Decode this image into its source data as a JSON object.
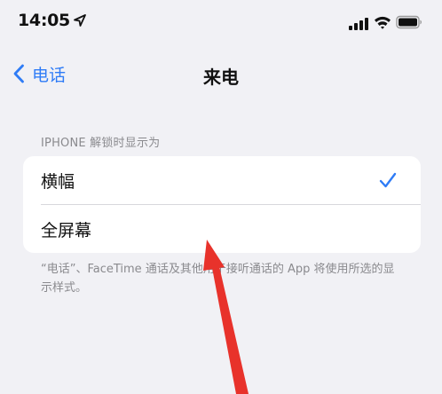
{
  "status_bar": {
    "time": "14:05",
    "icons": [
      "location-arrow-icon",
      "cellular-signal-icon",
      "wifi-icon",
      "battery-icon"
    ]
  },
  "nav": {
    "back_label": "电话",
    "title": "来电"
  },
  "section": {
    "header": "IPHONE 解锁时显示为",
    "options": [
      {
        "label": "横幅",
        "selected": true
      },
      {
        "label": "全屏幕",
        "selected": false
      }
    ],
    "footer": "“电话”、FaceTime 通话及其他用于接听通话的 App 将使用所选的显示样式。"
  },
  "colors": {
    "accent": "#2f7cf6",
    "background": "#f1f1f5",
    "annotation_arrow": "#e8322b"
  }
}
